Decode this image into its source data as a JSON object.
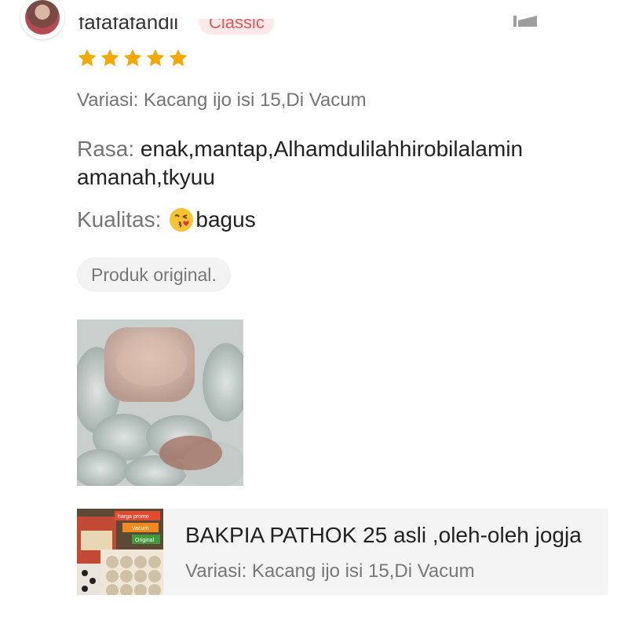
{
  "review": {
    "username": "fafafafandii",
    "tier_badge": "Classic",
    "rating": 5,
    "max_rating": 5,
    "variation": "Variasi: Kacang ijo isi 15,Di Vacum",
    "rasa_label": "Rasa:",
    "rasa_value": " enak,mantap,Alhamdulilahhirobilalamin amanah,tkyuu",
    "kualitas_label": "Kualitas:",
    "kualitas_emoji": "kissing-face-emoji",
    "kualitas_value": "bagus",
    "tag": "Produk original."
  },
  "product": {
    "name": "BAKPIA PATHOK 25 asli ,oleh-oleh jogja",
    "variation": "Variasi: Kacang ijo isi 15,Di Vacum",
    "thumb_labels": [
      "harga promo",
      "Vacum",
      "Original"
    ]
  },
  "icons": {
    "star": "star-icon",
    "more": "more-options-icon"
  },
  "colors": {
    "star": "#f6a700",
    "badge_bg": "#fde9e9",
    "badge_text": "#e05a5a",
    "muted_text": "#757575",
    "card_bg": "#f4f4f4"
  }
}
